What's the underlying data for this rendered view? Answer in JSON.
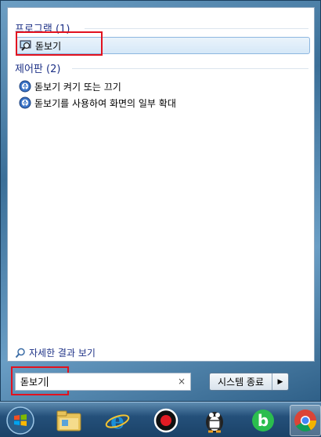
{
  "programs": {
    "header": "프로그램 (1)",
    "items": [
      {
        "label": "돋보기",
        "icon": "magnifier-app-icon"
      }
    ]
  },
  "control_panel": {
    "header": "제어판 (2)",
    "items": [
      {
        "label": "돋보기 켜기 또는 끄기",
        "icon": "ease-of-access-icon"
      },
      {
        "label": "돋보기를 사용하여 화면의 일부 확대",
        "icon": "ease-of-access-icon"
      }
    ]
  },
  "see_more": {
    "label": "자세한 결과 보기",
    "icon": "search-icon"
  },
  "search": {
    "value": "돋보기",
    "clear": "×"
  },
  "shutdown": {
    "label": "시스템 종료",
    "arrow": "▶"
  },
  "taskbar": {
    "items": [
      "start-orb",
      "file-explorer-icon",
      "internet-explorer-icon",
      "record-icon",
      "penguin-app-icon",
      "b-app-icon",
      "chrome-icon"
    ]
  },
  "colors": {
    "highlight_box": "#e2121f",
    "header_text": "#1e3287"
  }
}
